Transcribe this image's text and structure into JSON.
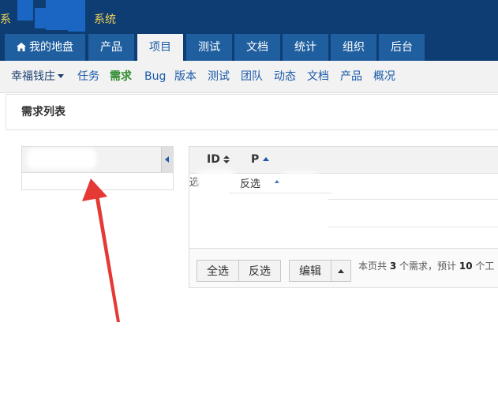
{
  "header": {
    "brand_lead": "系",
    "brand_text": "系统"
  },
  "main_nav": [
    {
      "label": "我的地盘",
      "icon": "home-icon"
    },
    {
      "label": "产品"
    },
    {
      "label": "项目",
      "active": true
    },
    {
      "label": "测试"
    },
    {
      "label": "文档"
    },
    {
      "label": "统计"
    },
    {
      "label": "组织"
    },
    {
      "label": "后台"
    }
  ],
  "sub_nav": {
    "project": "幸福钱庄",
    "items": [
      "任务",
      "需求",
      "Bug",
      "版本",
      "测试",
      "团队",
      "动态",
      "文档",
      "产品",
      "概况"
    ],
    "active": "需求"
  },
  "page": {
    "title": "需求列表"
  },
  "table": {
    "columns": [
      "ID",
      "P"
    ],
    "row_fragment_left": "选",
    "row_fragment_mid": "反选"
  },
  "footer": {
    "select_all": "全选",
    "invert": "反选",
    "edit": "编辑",
    "summary_prefix": "本页共",
    "summary_count": "3",
    "summary_mid": "个需求，预计",
    "summary_hours": "10",
    "summary_suffix": "个工"
  },
  "colors": {
    "header_bg": "#0e3d73",
    "tab_bg": "#1f5f9f",
    "link": "#1a5aa8",
    "active_green": "#2e8b2e",
    "brand_text": "#f1d357",
    "annotation": "#e53935"
  }
}
